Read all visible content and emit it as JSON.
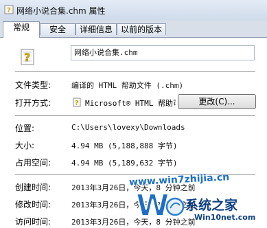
{
  "window": {
    "title": "网络小说合集.chm 属性"
  },
  "tabs": [
    {
      "label": "常规",
      "active": true
    },
    {
      "label": "安全",
      "active": false
    },
    {
      "label": "详细信息",
      "active": false
    },
    {
      "label": "以前的版本",
      "active": false
    }
  ],
  "general": {
    "file_name": "网络小说合集.chm",
    "file_type_label": "文件类型:",
    "file_type_value": "编译的 HTML 帮助文件 (.chm)",
    "opens_with_label": "打开方式:",
    "opens_with_app": "Microsoft® HTML 帮助可执行文件",
    "change_button": "更改(C)...",
    "location_label": "位置:",
    "location_value": "C:\\Users\\lovexy\\Downloads",
    "size_label": "大小:",
    "size_value": "4.94 MB (5,188,888 字节)",
    "size_on_disk_label": "占用空间:",
    "size_on_disk_value": "4.94 MB (5,189,632 字节)",
    "created_label": "创建时间:",
    "created_value": "2013年3月26日，今天，8 分钟之前",
    "modified_label": "修改时间:",
    "modified_value": "2013年3月26日，今天，8 分钟之前",
    "accessed_label": "访问时间:",
    "accessed_value": "2013年3月26日，今天，8 分钟之前"
  },
  "watermark": {
    "site": "www.win7zhijia.cn",
    "brand": "系统之家",
    "sub": "Win10net.com"
  },
  "colors": {
    "titlebar": "#d6e1ee",
    "background": "#ffffff",
    "watermark_blue": "#1d6fc4"
  },
  "icons": {
    "file": "chm-help-file-icon",
    "app": "html-help-app-icon"
  }
}
